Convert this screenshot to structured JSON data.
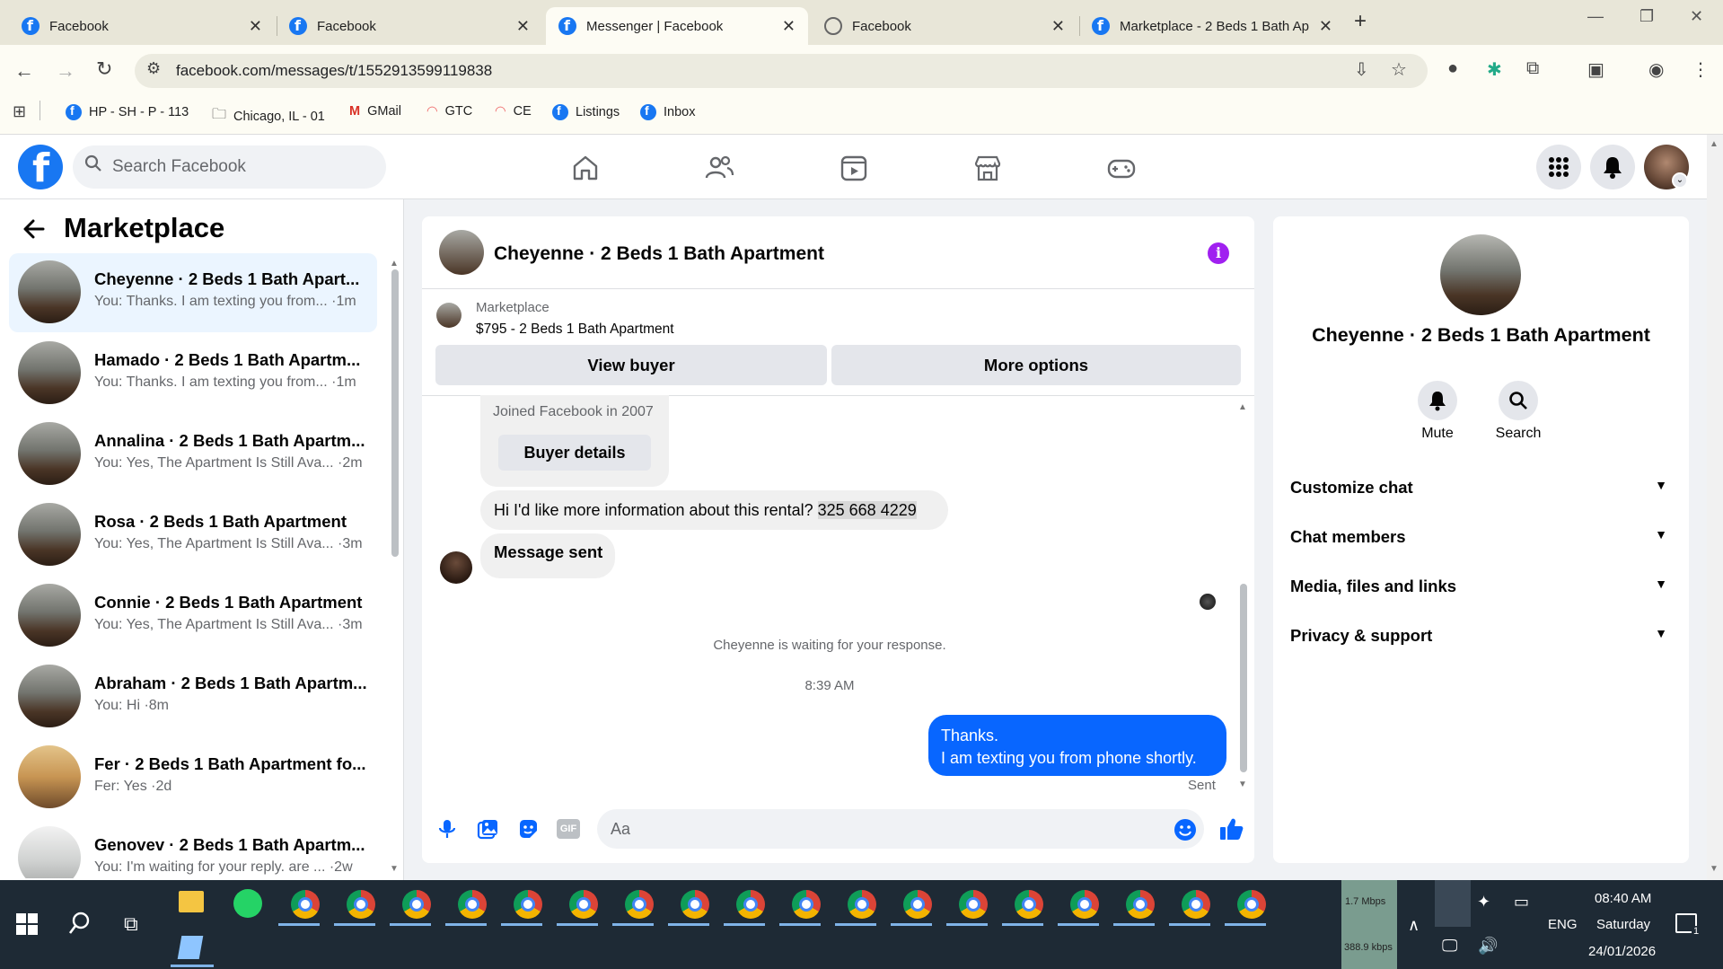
{
  "browser": {
    "tabs": [
      {
        "title": "Facebook",
        "icon": "facebook-icon"
      },
      {
        "title": "Facebook",
        "icon": "facebook-icon"
      },
      {
        "title": "Messenger | Facebook",
        "icon": "facebook-icon",
        "active": true
      },
      {
        "title": "Facebook",
        "icon": "loading-icon"
      },
      {
        "title": "Marketplace - 2 Beds 1 Bath Ap",
        "icon": "facebook-icon"
      }
    ],
    "url": "facebook.com/messages/t/1552913599119838",
    "bookmarks": [
      {
        "label": "HP - SH - P - 113",
        "icon": "facebook-icon"
      },
      {
        "label": "Chicago, IL - 01",
        "icon": "folder-icon"
      },
      {
        "label": "GMail",
        "icon": "gmail-icon"
      },
      {
        "label": "GTC",
        "icon": "rainbow-icon"
      },
      {
        "label": "CE",
        "icon": "rainbow-icon"
      },
      {
        "label": "Listings",
        "icon": "facebook-icon"
      },
      {
        "label": "Inbox",
        "icon": "facebook-icon"
      }
    ]
  },
  "fb": {
    "search_placeholder": "Search Facebook",
    "logo": "f"
  },
  "left": {
    "title": "Marketplace",
    "conversations": [
      {
        "name": "Cheyenne · 2 Beds 1 Bath Apart...",
        "preview": "You: Thanks. I am texting you from... ·1m",
        "selected": true
      },
      {
        "name": "Hamado · 2 Beds 1 Bath Apartm...",
        "preview": "You: Thanks. I am texting you from... ·1m"
      },
      {
        "name": "Annalina · 2 Beds 1 Bath Apartm...",
        "preview": "You: Yes, The Apartment Is Still Ava... ·2m"
      },
      {
        "name": "Rosa · 2 Beds 1 Bath Apartment",
        "preview": "You: Yes, The Apartment Is Still Ava... ·3m"
      },
      {
        "name": "Connie · 2 Beds 1 Bath Apartment",
        "preview": "You: Yes, The Apartment Is Still Ava... ·3m"
      },
      {
        "name": "Abraham · 2 Beds 1 Bath Apartm...",
        "preview": "You: Hi ·8m"
      },
      {
        "name": "Fer · 2 Beds 1 Bath Apartment fo...",
        "preview": "Fer: Yes ·2d"
      },
      {
        "name": "Genovev · 2 Beds 1 Bath Apartm...",
        "preview": "You: I'm waiting for your reply. are ... ·2w"
      }
    ]
  },
  "chat": {
    "title": "Cheyenne · 2 Beds 1 Bath Apartment",
    "marketplace_label": "Marketplace",
    "listing": "$795 - 2 Beds 1 Bath Apartment",
    "view_buyer": "View buyer",
    "more_options": "More options",
    "joined": "Joined Facebook in 2007",
    "buyer_details": "Buyer details",
    "msg1_text": "Hi I'd like more information about this rental?",
    "msg1_phone": "325 668 4229",
    "msg2": "Message sent",
    "waiting": "Cheyenne is waiting for your response.",
    "time": "8:39 AM",
    "out_line1": "Thanks.",
    "out_line2": "I am texting you from phone shortly.",
    "status": "Sent",
    "composer_placeholder": "Aa",
    "gif_label": "GIF"
  },
  "right": {
    "name": "Cheyenne · 2 Beds 1 Bath Apartment",
    "mute": "Mute",
    "search": "Search",
    "sections": [
      "Customize chat",
      "Chat members",
      "Media, files and links",
      "Privacy & support"
    ]
  },
  "taskbar": {
    "net_up": "1.7 Mbps",
    "net_down": "388.9 kbps",
    "lang": "ENG",
    "time": "08:40 AM",
    "day": "Saturday",
    "date": "24/01/2026",
    "notif_count": "1"
  },
  "colors": {
    "fb_blue": "#1877f2",
    "messenger_blue": "#0866ff",
    "info_purple": "#a020f0"
  }
}
